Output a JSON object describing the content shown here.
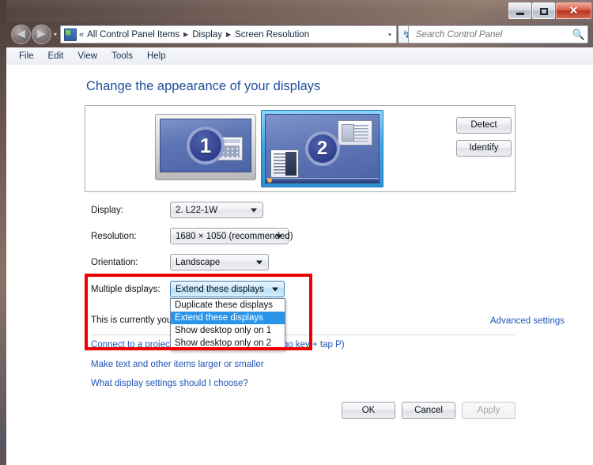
{
  "window": {
    "controls": {
      "minimize": "minimize-button",
      "maximize": "maximize-button",
      "close": "✕"
    }
  },
  "navbar": {
    "back_glyph": "◀",
    "forward_glyph": "▶",
    "dropdown_glyph": "▾",
    "breadcrumb_prefix": "«",
    "breadcrumbs": [
      "All Control Panel Items",
      "Display",
      "Screen Resolution"
    ],
    "breadcrumb_separator": "▶",
    "address_dropdown_glyph": "▾",
    "refresh_glyph": "↯",
    "search": {
      "placeholder": "Search Control Panel",
      "value": "",
      "icon": "search-icon"
    }
  },
  "menubar": {
    "items": [
      "File",
      "Edit",
      "View",
      "Tools",
      "Help"
    ]
  },
  "page": {
    "title": "Change the appearance of your displays"
  },
  "preview": {
    "monitor1": {
      "number": "1",
      "selected": false
    },
    "monitor2": {
      "number": "2",
      "selected": true
    },
    "buttons": {
      "detect": "Detect",
      "identify": "Identify"
    }
  },
  "form": {
    "display": {
      "label": "Display:",
      "value": "2. L22-1W"
    },
    "resolution": {
      "label": "Resolution:",
      "value": "1680 × 1050 (recommended)"
    },
    "orientation": {
      "label": "Orientation:",
      "value": "Landscape"
    },
    "multiple_displays": {
      "label": "Multiple displays:",
      "value": "Extend these displays",
      "expanded": true,
      "options": [
        "Duplicate these displays",
        "Extend these displays",
        "Show desktop only on 1",
        "Show desktop only on 2"
      ],
      "selected_index": 1
    }
  },
  "info": {
    "main_display_text": "This is currently your main display.",
    "advanced_settings_link": "Advanced settings"
  },
  "links": {
    "projector": "Connect to a projector (or press the Windows logo key + tap P)",
    "larger_smaller": "Make text and other items larger or smaller",
    "what_settings": "What display settings should I choose?"
  },
  "footer": {
    "ok": "OK",
    "cancel": "Cancel",
    "apply": "Apply"
  },
  "colors": {
    "highlight_box": "#ee0000",
    "link": "#1f55b8",
    "title": "#1f4e9c",
    "selection": "#2a95e8"
  }
}
